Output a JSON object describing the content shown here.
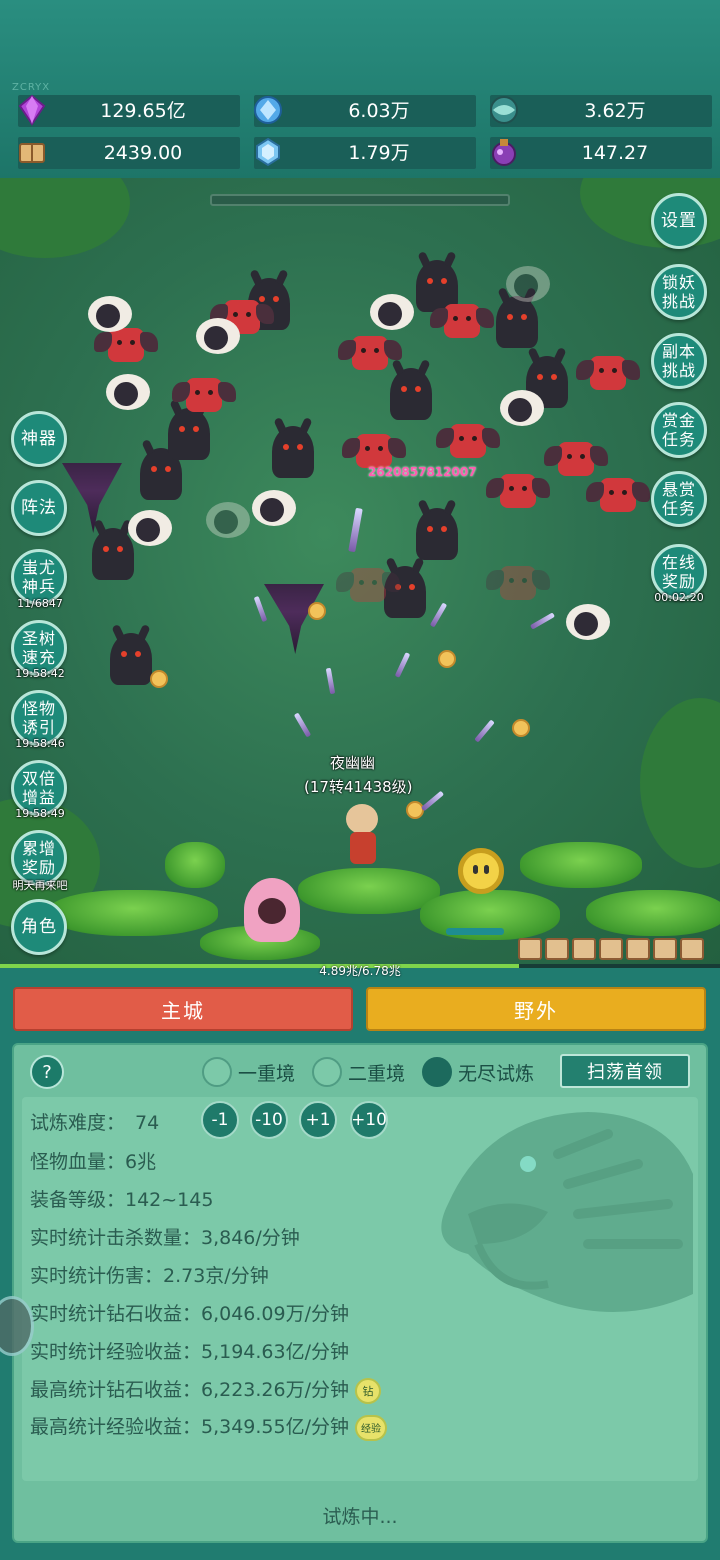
{
  "top": {
    "watermark": "ZCRYX",
    "resources": [
      {
        "icon": "purple-gem-icon",
        "value": "129.65亿"
      },
      {
        "icon": "blue-crystal-icon",
        "value": "6.03万"
      },
      {
        "icon": "orb-icon",
        "value": "3.62万"
      },
      {
        "icon": "book-icon",
        "value": "2439.00"
      },
      {
        "icon": "ice-crystal-icon",
        "value": "1.79万"
      },
      {
        "icon": "potion-icon",
        "value": "147.27"
      }
    ]
  },
  "battle": {
    "damage_text": "2620857812007",
    "hero_name": "夜幽幽",
    "hero_level": "(17转41438级)",
    "exp_text": "4.89兆/6.78兆",
    "exp_fraction": 0.721
  },
  "left_buttons": [
    {
      "label": "神器",
      "timer": ""
    },
    {
      "label": "阵法",
      "timer": ""
    },
    {
      "label": "蚩尤神兵",
      "timer": "11/6847"
    },
    {
      "label": "圣树速充",
      "timer": "19:58:42"
    },
    {
      "label": "怪物诱引",
      "timer": "19:58:46"
    },
    {
      "label": "双倍增益",
      "timer": "19:58:49"
    },
    {
      "label": "累增奖励",
      "timer": "明天再来吧"
    },
    {
      "label": "角色",
      "timer": ""
    }
  ],
  "right_buttons": [
    {
      "label": "设置",
      "timer": ""
    },
    {
      "label": "锁妖挑战",
      "timer": ""
    },
    {
      "label": "副本挑战",
      "timer": ""
    },
    {
      "label": "赏金任务",
      "timer": ""
    },
    {
      "label": "悬赏任务",
      "timer": ""
    },
    {
      "label": "在线奖励",
      "timer": "00:02:20"
    }
  ],
  "nav": {
    "city": "主城",
    "wild": "野外"
  },
  "panel": {
    "help": "?",
    "modes": [
      "一重境",
      "二重境",
      "无尽试炼"
    ],
    "selected_mode": "无尽试炼",
    "sweep_button": "扫荡首领",
    "difficulty_label": "试炼难度：",
    "difficulty_value": "74",
    "steps": [
      "-1",
      "-10",
      "+1",
      "+10"
    ],
    "stats": [
      "怪物血量：6兆",
      "装备等级：142~145",
      "实时统计击杀数量：3,846/分钟",
      "实时统计伤害：2.73京/分钟",
      "实时统计钻石收益：6,046.09万/分钟",
      "实时统计经验收益：5,194.63亿/分钟",
      "最高统计钻石收益：6,223.26万/分钟",
      "最高统计经验收益：5,349.55亿/分钟"
    ],
    "badge_diamond": "钻",
    "badge_exp": "经验",
    "status": "试炼中..."
  }
}
